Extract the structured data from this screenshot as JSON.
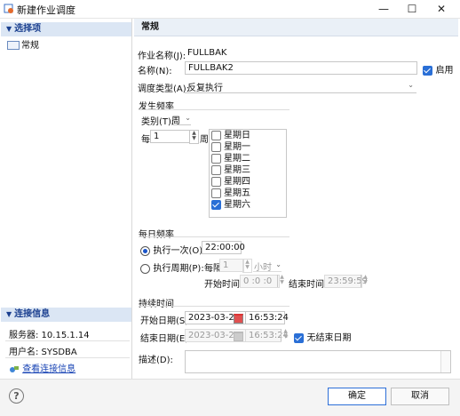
{
  "window": {
    "title": "新建作业调度",
    "minimize": "—",
    "maximize": "☐",
    "close": "✕"
  },
  "sidebar": {
    "options_header": "选择项",
    "items": [
      {
        "label": "常规"
      }
    ],
    "conn_header": "连接信息",
    "server": "服务器: 10.15.1.14",
    "user": "用户名: SYSDBA",
    "view_conn": "查看连接信息"
  },
  "main": {
    "header": "常规",
    "job_name_label": "作业名称(J):",
    "job_name_value": "FULLBAK",
    "name_label": "名称(N):",
    "name_value": "FULLBAK2",
    "enable_label": "启用",
    "enable_checked": true,
    "sched_type_label": "调度类型(A):",
    "sched_type_value": "反复执行",
    "frequency": {
      "title": "发生频率",
      "category_label": "类别(T):",
      "category_value": "周",
      "every_label": "每",
      "every_value": "1",
      "unit": "周",
      "days": [
        {
          "label": "星期日",
          "checked": false
        },
        {
          "label": "星期一",
          "checked": false
        },
        {
          "label": "星期二",
          "checked": false
        },
        {
          "label": "星期三",
          "checked": false
        },
        {
          "label": "星期四",
          "checked": false
        },
        {
          "label": "星期五",
          "checked": false
        },
        {
          "label": "星期六",
          "checked": true
        }
      ]
    },
    "daily": {
      "title": "每日频率",
      "once_label": "执行一次(O):",
      "once_value": "22:00:00",
      "periodic_label": "执行周期(P):",
      "every_label": "每隔",
      "every_value": "1",
      "every_unit": "小时",
      "start_label": "开始时间:",
      "start_value": "0 :0 :0",
      "end_label": "结束时间:",
      "end_value": "23:59:59"
    },
    "duration": {
      "title": "持续时间",
      "start_date_label": "开始日期(S):",
      "start_date": "2023-03-20",
      "start_time": "16:53:24",
      "end_date_label": "结束日期(E):",
      "end_date": "2023-03-20",
      "end_time": "16:53:24",
      "no_end_label": "无结束日期",
      "no_end_checked": true
    },
    "desc_label": "描述(D):"
  },
  "footer": {
    "ok": "确定",
    "cancel": "取消",
    "help": "?"
  }
}
